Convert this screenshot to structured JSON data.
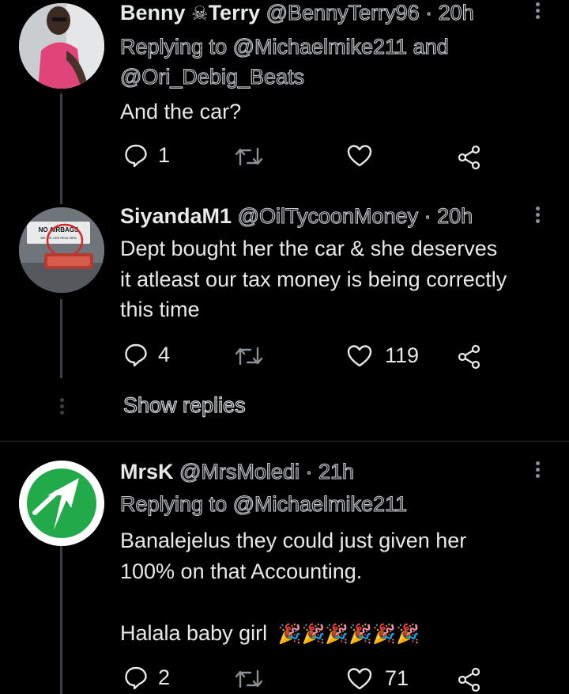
{
  "tweets": [
    {
      "display_name": "Benny",
      "name_emoji": "☠",
      "display_name_2": "Terry",
      "handle": "@BennyTerry96",
      "time": "· 20h",
      "replying_prefix": "Replying to",
      "replying_to_1": "@Michaelmike211",
      "replying_and": "and",
      "replying_to_2": "@Ori_Debig_Beats",
      "text": "And the car?",
      "replies": "1",
      "retweets": "",
      "likes": ""
    },
    {
      "display_name": "SiyandaM1",
      "handle": "@OilTycoonMoney",
      "time": "· 20h",
      "text_lines": [
        "Dept bought her the car & she deserves",
        "it atleast our tax money is being correctly",
        "this time"
      ],
      "avatar_sticker": "NO AIRBAGS",
      "avatar_sticker_sub": "WE DIE LIKE REAL MEN",
      "replies": "4",
      "likes": "119"
    },
    {
      "display_name": "MrsK",
      "handle": "@MrsMoledi",
      "time": "· 21h",
      "replying_prefix": "Replying to",
      "replying_to_1": "@Michaelmike211",
      "text_lines": [
        "Banalejelus they could just given her",
        "100% on that Accounting."
      ],
      "text_line_3": "Halala baby girl",
      "emoji": "🎉🎉🎉🎉🎉🎉",
      "replies": "2",
      "likes": "71"
    }
  ],
  "show_replies": "Show replies",
  "colors": {
    "background": "#000000",
    "text": "#e7e9ea",
    "muted": "#8b9096",
    "thread_line": "#3a3f44",
    "avatar_green": "#22a94a"
  }
}
